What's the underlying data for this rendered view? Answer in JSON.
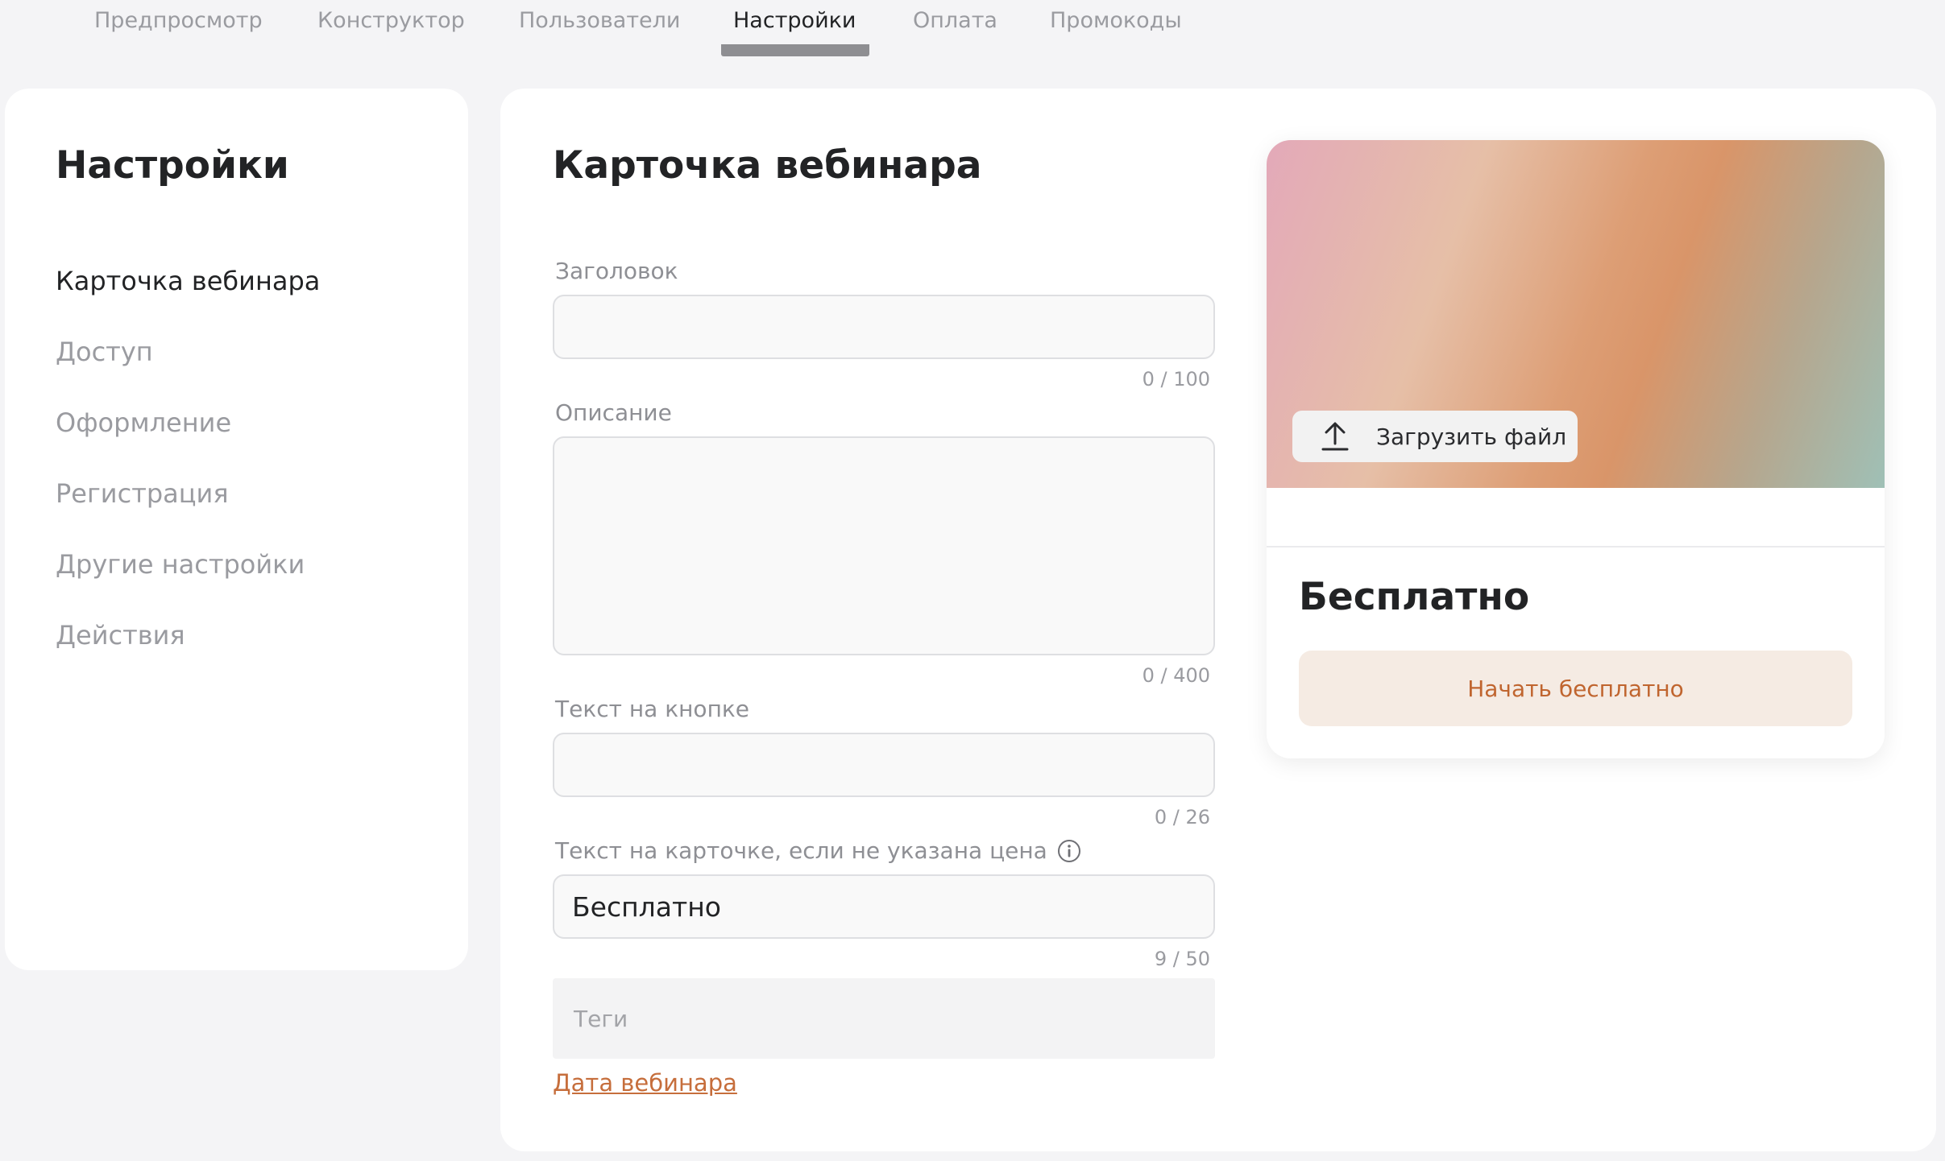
{
  "tabs": [
    {
      "label": "Предпросмотр"
    },
    {
      "label": "Конструктор"
    },
    {
      "label": "Пользователи"
    },
    {
      "label": "Настройки"
    },
    {
      "label": "Оплата"
    },
    {
      "label": "Промокоды"
    }
  ],
  "active_tab": "Настройки",
  "sidebar": {
    "title": "Настройки",
    "items": [
      {
        "label": "Карточка вебинара"
      },
      {
        "label": "Доступ"
      },
      {
        "label": "Оформление"
      },
      {
        "label": "Регистрация"
      },
      {
        "label": "Другие настройки"
      },
      {
        "label": "Действия"
      }
    ],
    "active_item": "Карточка вебинара"
  },
  "main": {
    "title": "Карточка вебинара",
    "fields": {
      "heading": {
        "label": "Заголовок",
        "value": "",
        "counter": "0 / 100"
      },
      "description": {
        "label": "Описание",
        "value": "",
        "counter": "0 / 400"
      },
      "button_text": {
        "label": "Текст на кнопке",
        "value": "",
        "counter": "0 / 26"
      },
      "card_text": {
        "label": "Текст на карточке, если не указана цена",
        "value": "Бесплатно",
        "counter": "9 / 50",
        "icon": "info-icon"
      },
      "tags": {
        "placeholder": "Теги"
      }
    },
    "date_link": "Дата вебинара"
  },
  "preview": {
    "upload_label": "Загрузить файл",
    "upload_icon": "upload-icon",
    "price": "Бесплатно",
    "start_button": "Начать бесплатно"
  },
  "colors": {
    "accent": "#c66e3c",
    "button_bg": "#f5ebe3",
    "background": "#f4f4f6"
  }
}
